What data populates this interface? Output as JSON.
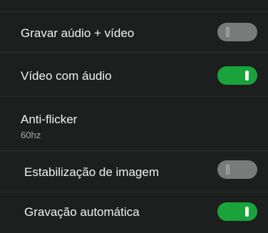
{
  "settings": [
    {
      "label": "Gravar aúdio + vídeo",
      "enabled": false
    },
    {
      "label": "Vídeo com áudio",
      "enabled": true
    },
    {
      "label": "Anti-flicker",
      "value": "60hz"
    },
    {
      "label": "Estabilização de imagem",
      "enabled": false
    },
    {
      "label": "Gravação automática",
      "enabled": true
    }
  ],
  "colors": {
    "background": "#1c1f1e",
    "toggle_on": "#19a33a",
    "toggle_off": "#777b79",
    "divider": "#2b2f2d"
  }
}
